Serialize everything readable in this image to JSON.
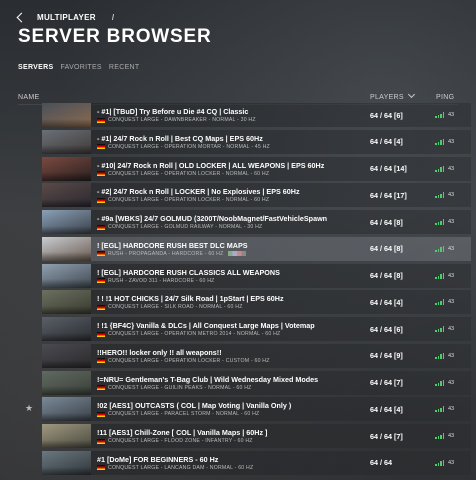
{
  "breadcrumb": {
    "parent": "MULTIPLAYER",
    "separator": "/"
  },
  "title": "SERVER BROWSER",
  "tabs": [
    "SERVERS",
    "FAVORITES",
    "RECENT"
  ],
  "columns": {
    "name": "NAME",
    "players": "PLAYERS",
    "ping": "PING"
  },
  "servers": [
    {
      "name": "- #1| [TBuD] Try Before u Die #4 CQ | Classic",
      "details": "CONQUEST LARGE - DAWNBREAKER - NORMAL - 30 HZ",
      "players": "64 / 64 [6]",
      "ping": "43"
    },
    {
      "name": "- #1| 24/7 Rock n Roll | Best CQ Maps | EPS 60Hz",
      "details": "CONQUEST LARGE - OPERATION MORTAR - NORMAL - 45 HZ",
      "players": "64 / 64 [4]",
      "ping": "43"
    },
    {
      "name": "- #10| 24/7 Rock n Roll | OLD LOCKER | ALL WEAPONS | EPS 60Hz",
      "details": "CONQUEST LARGE - OPERATION LOCKER - NORMAL - 60 HZ",
      "players": "64 / 64 [14]",
      "ping": "43"
    },
    {
      "name": "- #2| 24/7 Rock n Roll | LOCKER | No Explosives | EPS 60Hz",
      "details": "CONQUEST LARGE - OPERATION LOCKER - NORMAL - 60 HZ",
      "players": "64 / 64 [17]",
      "ping": "43"
    },
    {
      "name": "- #9a [WBKS] 24/7 GOLMUD (3200T/NoobMagnet/FastVehicleSpawn",
      "details": "CONQUEST LARGE - GOLMUD RAILWAY - NORMAL - 30 HZ",
      "players": "64 / 64 [8]",
      "ping": "43"
    },
    {
      "name": "! [EGL] HARDCORE RUSH BEST DLC MAPS",
      "details": "RUSH - PROPAGANDA - HARDCORE - 60 HZ",
      "players": "64 / 64 [8]",
      "ping": "43"
    },
    {
      "name": "! [EGL] HARDCORE RUSH CLASSICS ALL WEAPONS",
      "details": "RUSH - ZAVOD 311 - HARDCORE - 60 HZ",
      "players": "64 / 64 [8]",
      "ping": "43"
    },
    {
      "name": "! ! !1 HOT CHICKS | 24/7 Silk Road | 1pStart | EPS 60Hz",
      "details": "CONQUEST LARGE - SILK ROAD - NORMAL - 60 HZ",
      "players": "64 / 64 [4]",
      "ping": "43"
    },
    {
      "name": "! !1 {BF4C} Vanilla & DLCs | All Conquest Large Maps | Votemap",
      "details": "CONQUEST LARGE - OPERATION METRO 2014 - NORMAL - 60 HZ",
      "players": "64 / 64 [6]",
      "ping": "43"
    },
    {
      "name": "!!HERO!! locker only !! all weapons!!",
      "details": "CONQUEST LARGE - OPERATION LOCKER - CUSTOM - 60 HZ",
      "players": "64 / 64 [9]",
      "ping": "43"
    },
    {
      "name": "!=NRU= Gentleman's T-Bag Club | Wild Wednesday Mixed Modes",
      "details": "CONQUEST LARGE - GUILIN PEAKS - NORMAL - 60 HZ",
      "players": "64 / 64 [7]",
      "ping": "43"
    },
    {
      "name": "!02 [AES1] OUTCASTS  ( COL | Map Voting | Vanilla Only )",
      "details": "CONQUEST LARGE - PARACEL STORM - NORMAL - 60 HZ",
      "players": "64 / 64 [4]",
      "ping": "43"
    },
    {
      "name": "!11 [AES1] Chill-Zone [ COL | Vanilla Maps | 60Hz ]",
      "details": "CONQUEST LARGE - FLOOD ZONE - INFANTRY - 60 HZ",
      "players": "64 / 64 [7]",
      "ping": "43"
    },
    {
      "name": "#1 [DoMe] FOR BEGINNERS - 60 Hz",
      "details": "CONQUEST LARGE - LANCANG DAM - NORMAL - 60 HZ",
      "players": "64 / 64",
      "ping": "43"
    }
  ],
  "thumb_colors": [
    [
      "#4a5058",
      "#8a6a50"
    ],
    [
      "#6a7078",
      "#403a38"
    ],
    [
      "#7a4a40",
      "#2a2020"
    ],
    [
      "#5a4a48",
      "#2a2830"
    ],
    [
      "#8aa0b8",
      "#3a4048"
    ],
    [
      "#c8ccd0",
      "#6a5a50"
    ],
    [
      "#90a0b0",
      "#404850"
    ],
    [
      "#6a7060",
      "#3a3a30"
    ],
    [
      "#5a6068",
      "#2a2c30"
    ],
    [
      "#4a4a50",
      "#2a2a2e"
    ],
    [
      "#606a60",
      "#3a403a"
    ],
    [
      "#7a8a98",
      "#3a4048"
    ],
    [
      "#a09880",
      "#4a4a40"
    ],
    [
      "#6a7880",
      "#30363a"
    ]
  ],
  "highlight_row": 5,
  "favorite_row": 11,
  "star_icon": "★",
  "accent_ping": "#4ccf6a"
}
